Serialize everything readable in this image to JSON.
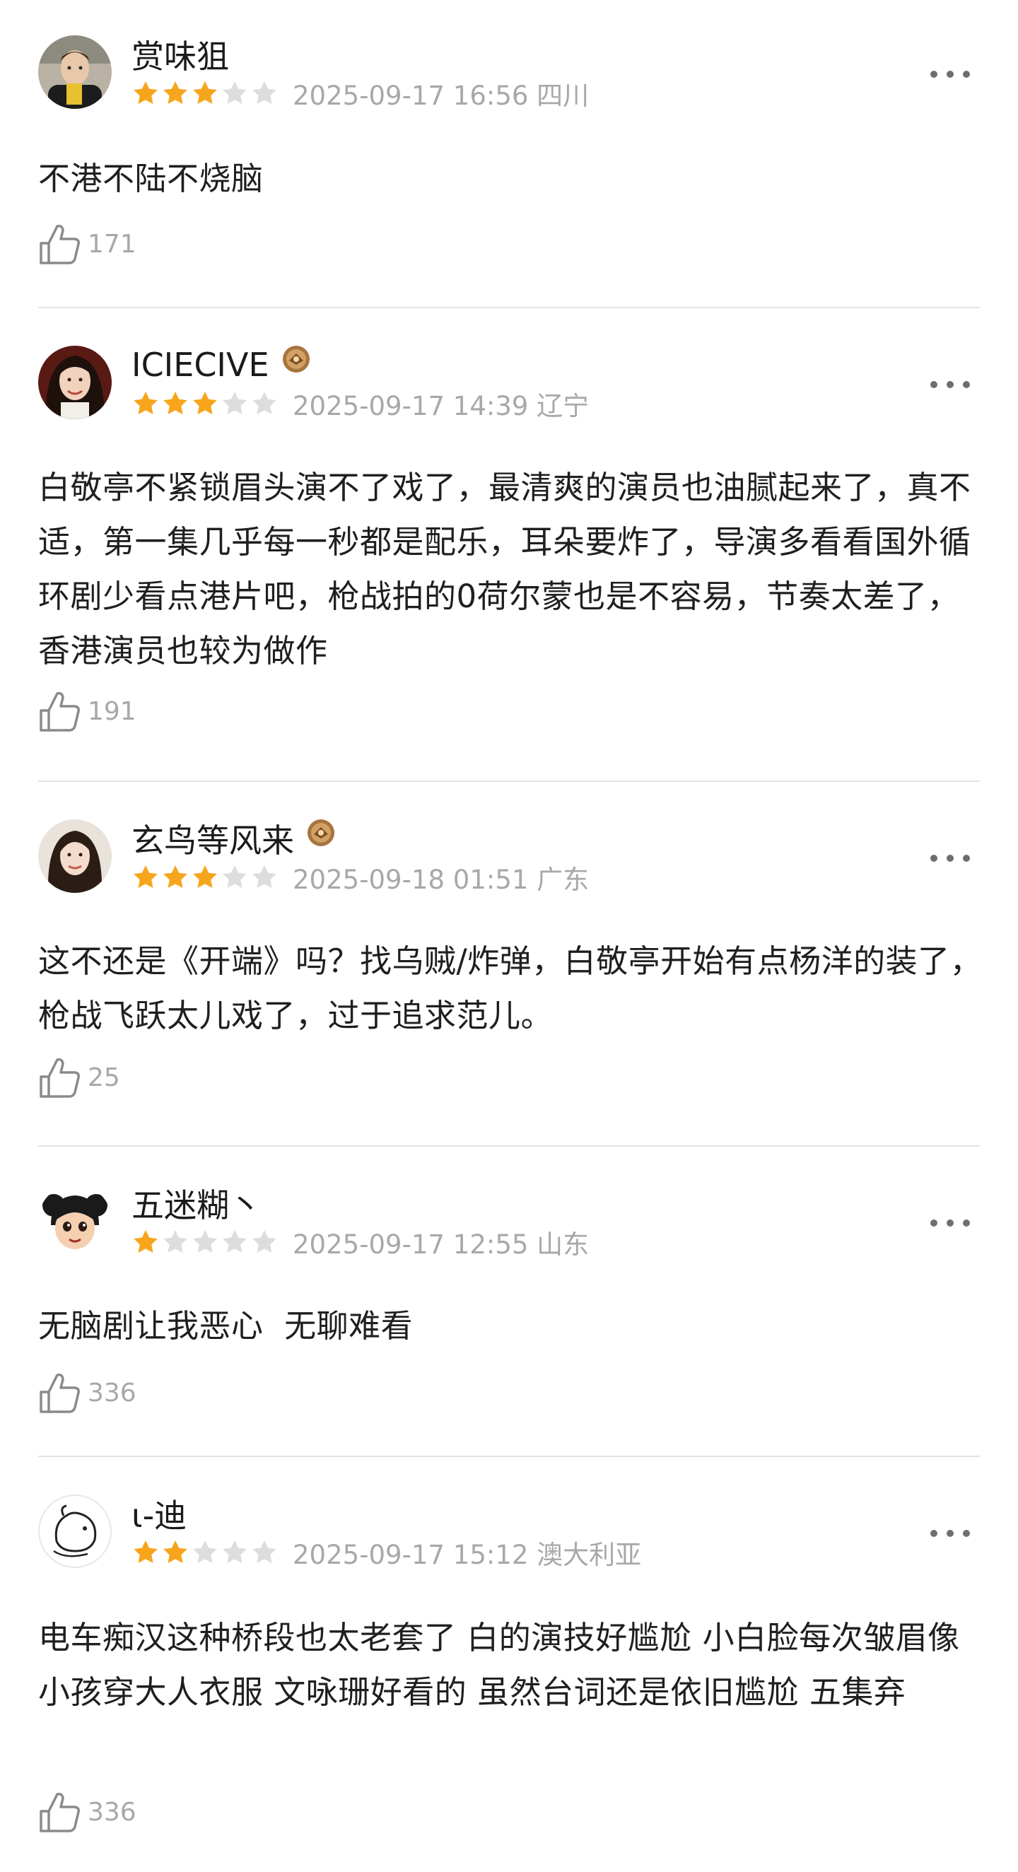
{
  "colors": {
    "star_filled": "#f7a51c",
    "star_empty": "#dddddd",
    "meta_text": "#a8a8a8",
    "divider": "#e2e2e2"
  },
  "icons": {
    "more": "more-horizontal-icon",
    "like": "thumbs-up-icon",
    "star": "star-icon",
    "badge": "medal-badge-icon"
  },
  "reviews": [
    {
      "username": "赏味狙",
      "rating": 3,
      "meta": "2025-09-17 16:56 四川",
      "content": "不港不陆不烧脑",
      "likes": "171",
      "has_badge": false
    },
    {
      "username": "ICIECIVE",
      "rating": 3,
      "meta": "2025-09-17 14:39 辽宁",
      "content": "白敬亭不紧锁眉头演不了戏了，最清爽的演员也油腻起来了，真不适，第一集几乎每一秒都是配乐，耳朵要炸了，导演多看看国外循环剧少看点港片吧，枪战拍的0荷尔蒙也是不容易，节奏太差了，香港演员也较为做作",
      "likes": "191",
      "has_badge": true
    },
    {
      "username": "玄鸟等风来",
      "rating": 3,
      "meta": "2025-09-18 01:51 广东",
      "content": "这不还是《开端》吗？找乌贼/炸弹，白敬亭开始有点杨洋的装了，枪战飞跃太儿戏了，过于追求范儿。",
      "likes": "25",
      "has_badge": true
    },
    {
      "username": "五迷糊丶",
      "rating": 1,
      "meta": "2025-09-17 12:55 山东",
      "content": "无脑剧让我恶心  无聊难看",
      "likes": "336",
      "has_badge": false
    },
    {
      "username": "ι-迪",
      "rating": 2,
      "meta": "2025-09-17 15:12 澳大利亚",
      "content": "电车痴汉这种桥段也太老套了 白的演技好尴尬 小白脸每次皱眉像小孩穿大人衣服 文咏珊好看的 虽然台词还是依旧尴尬 五集弃",
      "likes": "336",
      "has_badge": false
    }
  ]
}
